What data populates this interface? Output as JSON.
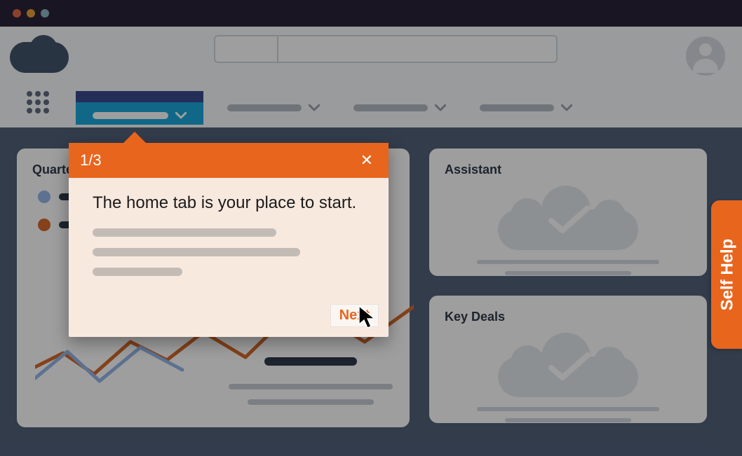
{
  "popover": {
    "step": "1/3",
    "close": "✕",
    "title": "The home tab is your place to start.",
    "next": "Next"
  },
  "cards": {
    "quarterly": {
      "title": "Quartely"
    },
    "assistant": {
      "title": "Assistant"
    },
    "keydeals": {
      "title": "Key Deals"
    }
  },
  "selfhelp": {
    "label": "Self Help"
  },
  "colors": {
    "accent": "#e8651e",
    "blue": "#1ba6dc",
    "navy": "#3a4a8e"
  }
}
